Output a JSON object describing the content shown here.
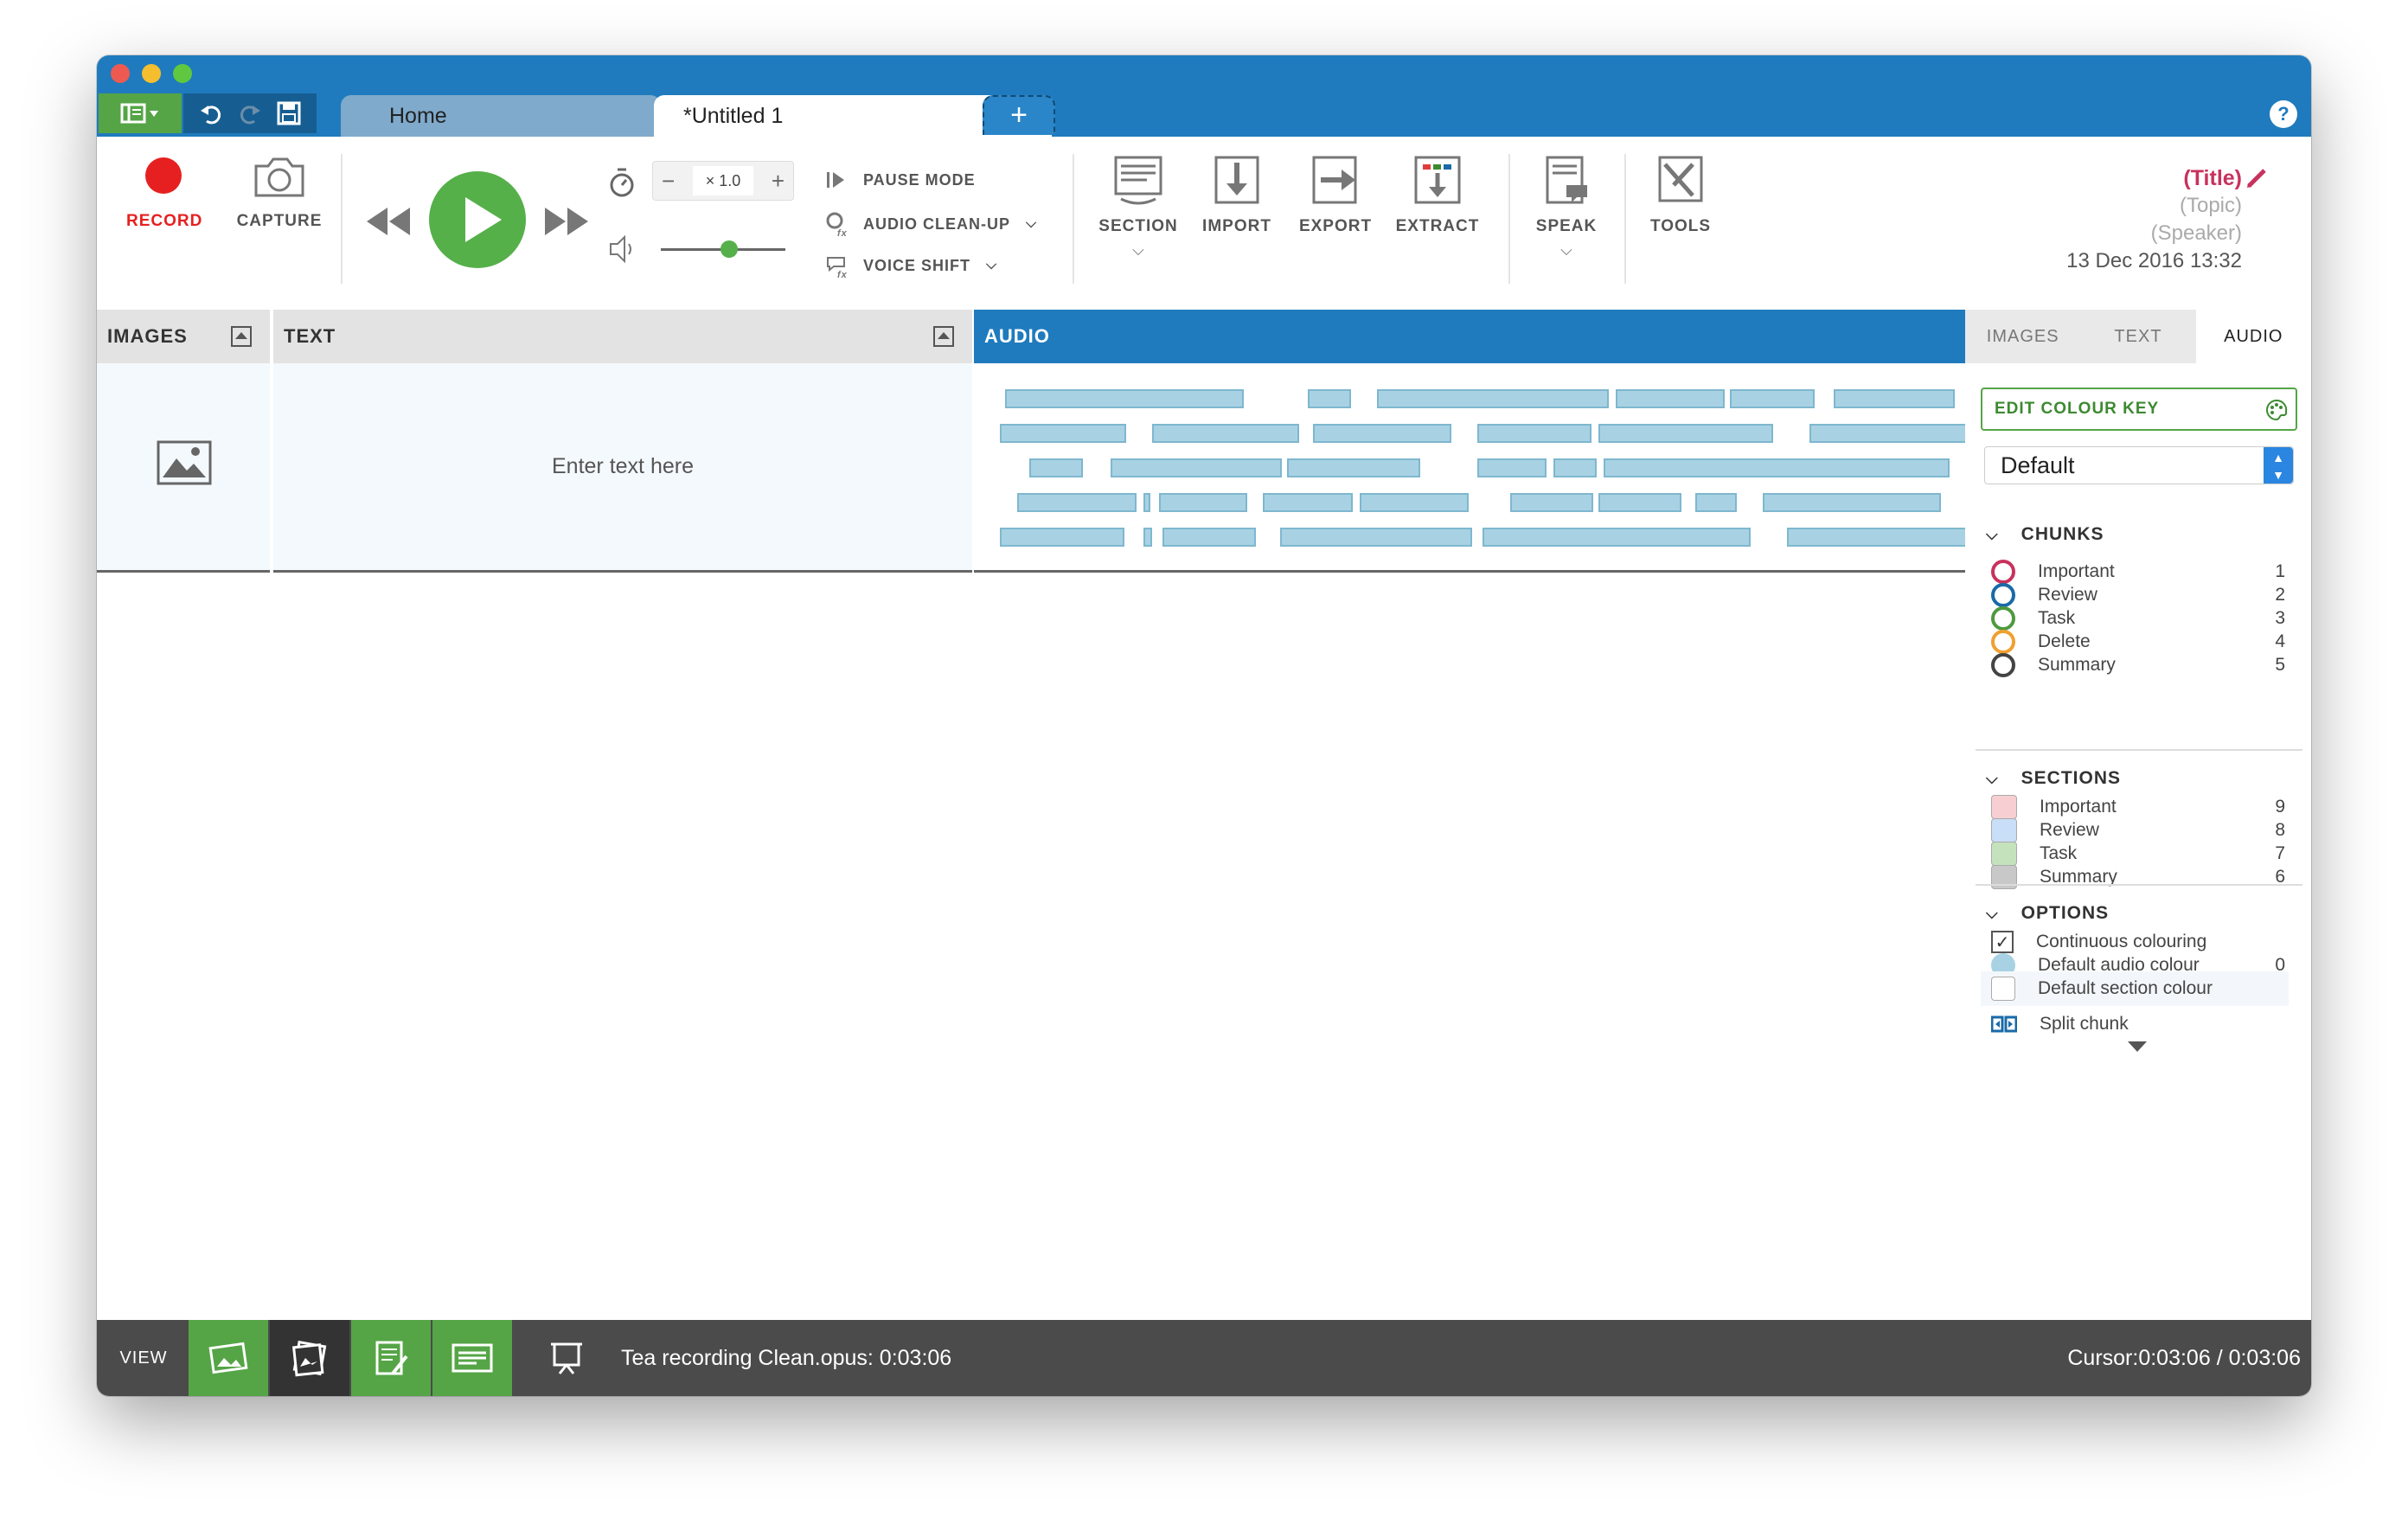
{
  "tabs": {
    "home": "Home",
    "untitled": "*Untitled 1",
    "close": "×",
    "add": "+",
    "help": "?"
  },
  "ribbon": {
    "record": "RECORD",
    "capture": "CAPTURE",
    "speed": "× 1.0",
    "speed_minus": "−",
    "speed_plus": "+",
    "pause_mode": "PAUSE MODE",
    "audio_cleanup": "AUDIO CLEAN-UP",
    "voice_shift": "VOICE SHIFT",
    "section": "SECTION",
    "import": "IMPORT",
    "export": "EXPORT",
    "extract": "EXTRACT",
    "speak": "SPEAK",
    "tools": "TOOLS",
    "volume_level": 0.55
  },
  "meta": {
    "title": "(Title)",
    "topic": "(Topic)",
    "speaker": "(Speaker)",
    "date": "13 Dec 2016 13:32"
  },
  "panels": {
    "images": "IMAGES",
    "text": "TEXT",
    "audio": "AUDIO",
    "text_placeholder": "Enter text here"
  },
  "sidebar": {
    "tabs": [
      "IMAGES",
      "TEXT",
      "AUDIO"
    ],
    "active_tab": "AUDIO",
    "edit_colour_key": "EDIT COLOUR KEY",
    "colour_key_select": "Default",
    "chunks_title": "CHUNKS",
    "chunks": [
      {
        "label": "Important",
        "count": "1",
        "color": "#c8325e"
      },
      {
        "label": "Review",
        "count": "2",
        "color": "#1a6aa8"
      },
      {
        "label": "Task",
        "count": "3",
        "color": "#4e9a3e"
      },
      {
        "label": "Delete",
        "count": "4",
        "color": "#f0a030"
      },
      {
        "label": "Summary",
        "count": "5",
        "color": "#444444"
      }
    ],
    "sections_title": "SECTIONS",
    "sections": [
      {
        "label": "Important",
        "count": "9",
        "color": "#f7cfd2"
      },
      {
        "label": "Review",
        "count": "8",
        "color": "#c9def7"
      },
      {
        "label": "Task",
        "count": "7",
        "color": "#c4e3bd"
      },
      {
        "label": "Summary",
        "count": "6",
        "color": "#c8c8c8"
      }
    ],
    "options_title": "OPTIONS",
    "continuous_colouring": "Continuous colouring",
    "default_audio_colour": "Default audio colour",
    "default_audio_colour_count": "0",
    "default_section_colour": "Default section colour",
    "split_chunk": "Split chunk"
  },
  "footer": {
    "view": "VIEW",
    "file_status": "Tea recording Clean.opus: 0:03:06",
    "cursor": "Cursor:0:03:06 / 0:03:06"
  },
  "colors": {
    "accent_blue": "#1f7bbd",
    "record_red": "#e62020",
    "play_green": "#55b04a",
    "title_pink": "#c8325e"
  }
}
